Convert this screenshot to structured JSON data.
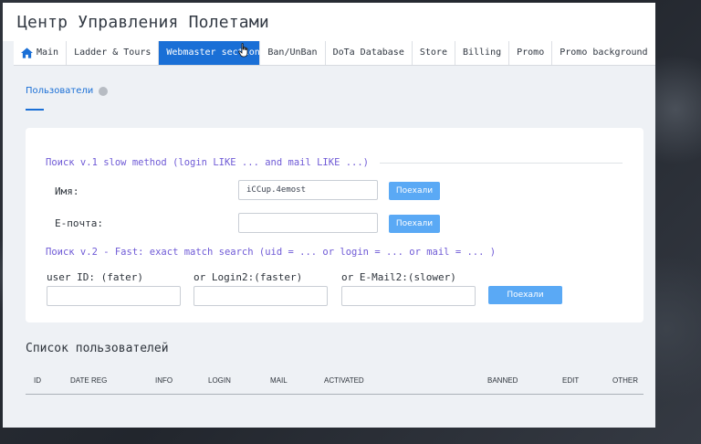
{
  "header": {
    "title": "Центр Управления Полетами"
  },
  "nav": {
    "items": [
      {
        "label": "Main"
      },
      {
        "label": "Ladder & Tours"
      },
      {
        "label": "Webmaster section"
      },
      {
        "label": "Ban/UnBan"
      },
      {
        "label": "DoTa Database"
      },
      {
        "label": "Store"
      },
      {
        "label": "Billing"
      },
      {
        "label": "Promo"
      },
      {
        "label": "Promo background"
      }
    ],
    "active_index": 2
  },
  "section": {
    "tab_label": "Пользователи"
  },
  "search_v1": {
    "title": "Поиск v.1 slow method (login LIKE ... and mail LIKE ...)",
    "name_label": "Имя:",
    "name_value": "iCCup.4emost",
    "email_label": "E-почта:",
    "email_value": "",
    "go_label": "Поехали"
  },
  "search_v2": {
    "title": "Поиск v.2 - Fast: exact match search (uid = ... or login = ... or mail = ... )",
    "uid_label": "user ID: (fater)",
    "uid_value": "",
    "login_label": "or Login2:(faster)",
    "login_value": "",
    "mail_label": "or E-Mail2:(slower)",
    "mail_value": "",
    "go_label": "Поехали"
  },
  "users_list": {
    "title": "Список пользователей",
    "columns": [
      "ID",
      "DATE REG",
      "INFO",
      "LOGIN",
      "MAIL",
      "ACTIVATED",
      "BANNED",
      "EDIT",
      "OTHER"
    ]
  },
  "colors": {
    "accent": "#1a6fd6",
    "button": "#5aa9f5",
    "group_title": "#6f5ad6"
  }
}
